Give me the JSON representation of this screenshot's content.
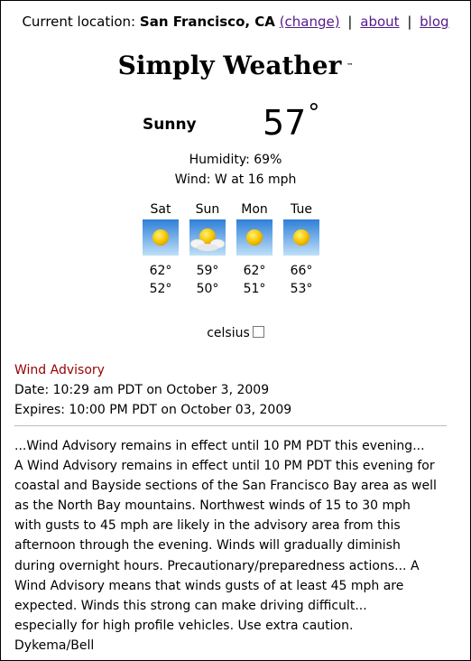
{
  "header": {
    "location_label": "Current location:",
    "city": "San Francisco, CA",
    "change_link": "(change)",
    "separator": "|",
    "about_link": "about",
    "blog_link": "blog"
  },
  "title": {
    "text": "Simply Weather",
    "tm": "™"
  },
  "current": {
    "condition": "Sunny",
    "temperature": "57",
    "degree": "°",
    "humidity": "Humidity: 69%",
    "wind": "Wind: W at 16 mph"
  },
  "forecast": [
    {
      "day": "Sat",
      "icon": "sunny-icon",
      "high": "62°",
      "low": "52°"
    },
    {
      "day": "Sun",
      "icon": "partly-cloudy-icon",
      "high": "59°",
      "low": "50°"
    },
    {
      "day": "Mon",
      "icon": "sunny-icon",
      "high": "62°",
      "low": "51°"
    },
    {
      "day": "Tue",
      "icon": "sunny-icon",
      "high": "66°",
      "low": "53°"
    }
  ],
  "units": {
    "label": "celsius",
    "checked": false
  },
  "alert": {
    "title": "Wind Advisory",
    "date": "Date: 10:29 am PDT on October 3, 2009",
    "expires": "Expires: 10:00 PM PDT on October 03, 2009",
    "lines": [
      "...Wind Advisory remains in effect until 10 PM PDT this evening...",
      "A Wind Advisory remains in effect until 10 PM PDT this evening for",
      "coastal and Bayside sections of the San Francisco Bay area as well",
      "as the North Bay mountains. Northwest winds of 15 to 30 mph",
      "with gusts to 45 mph are likely in the advisory area from this",
      "afternoon through the evening. Winds will gradually diminish",
      "during overnight hours. Precautionary/preparedness actions... A",
      "Wind Advisory means that winds gusts of at least 45 mph are",
      "expected. Winds this strong can make driving difficult...",
      "especially for high profile vehicles. Use extra caution.",
      "Dykema/Bell"
    ]
  },
  "colors": {
    "link": "#551a8b",
    "alert_title": "#990000",
    "icon_sky": "#3c8fe0",
    "sun": "#f5c400"
  }
}
